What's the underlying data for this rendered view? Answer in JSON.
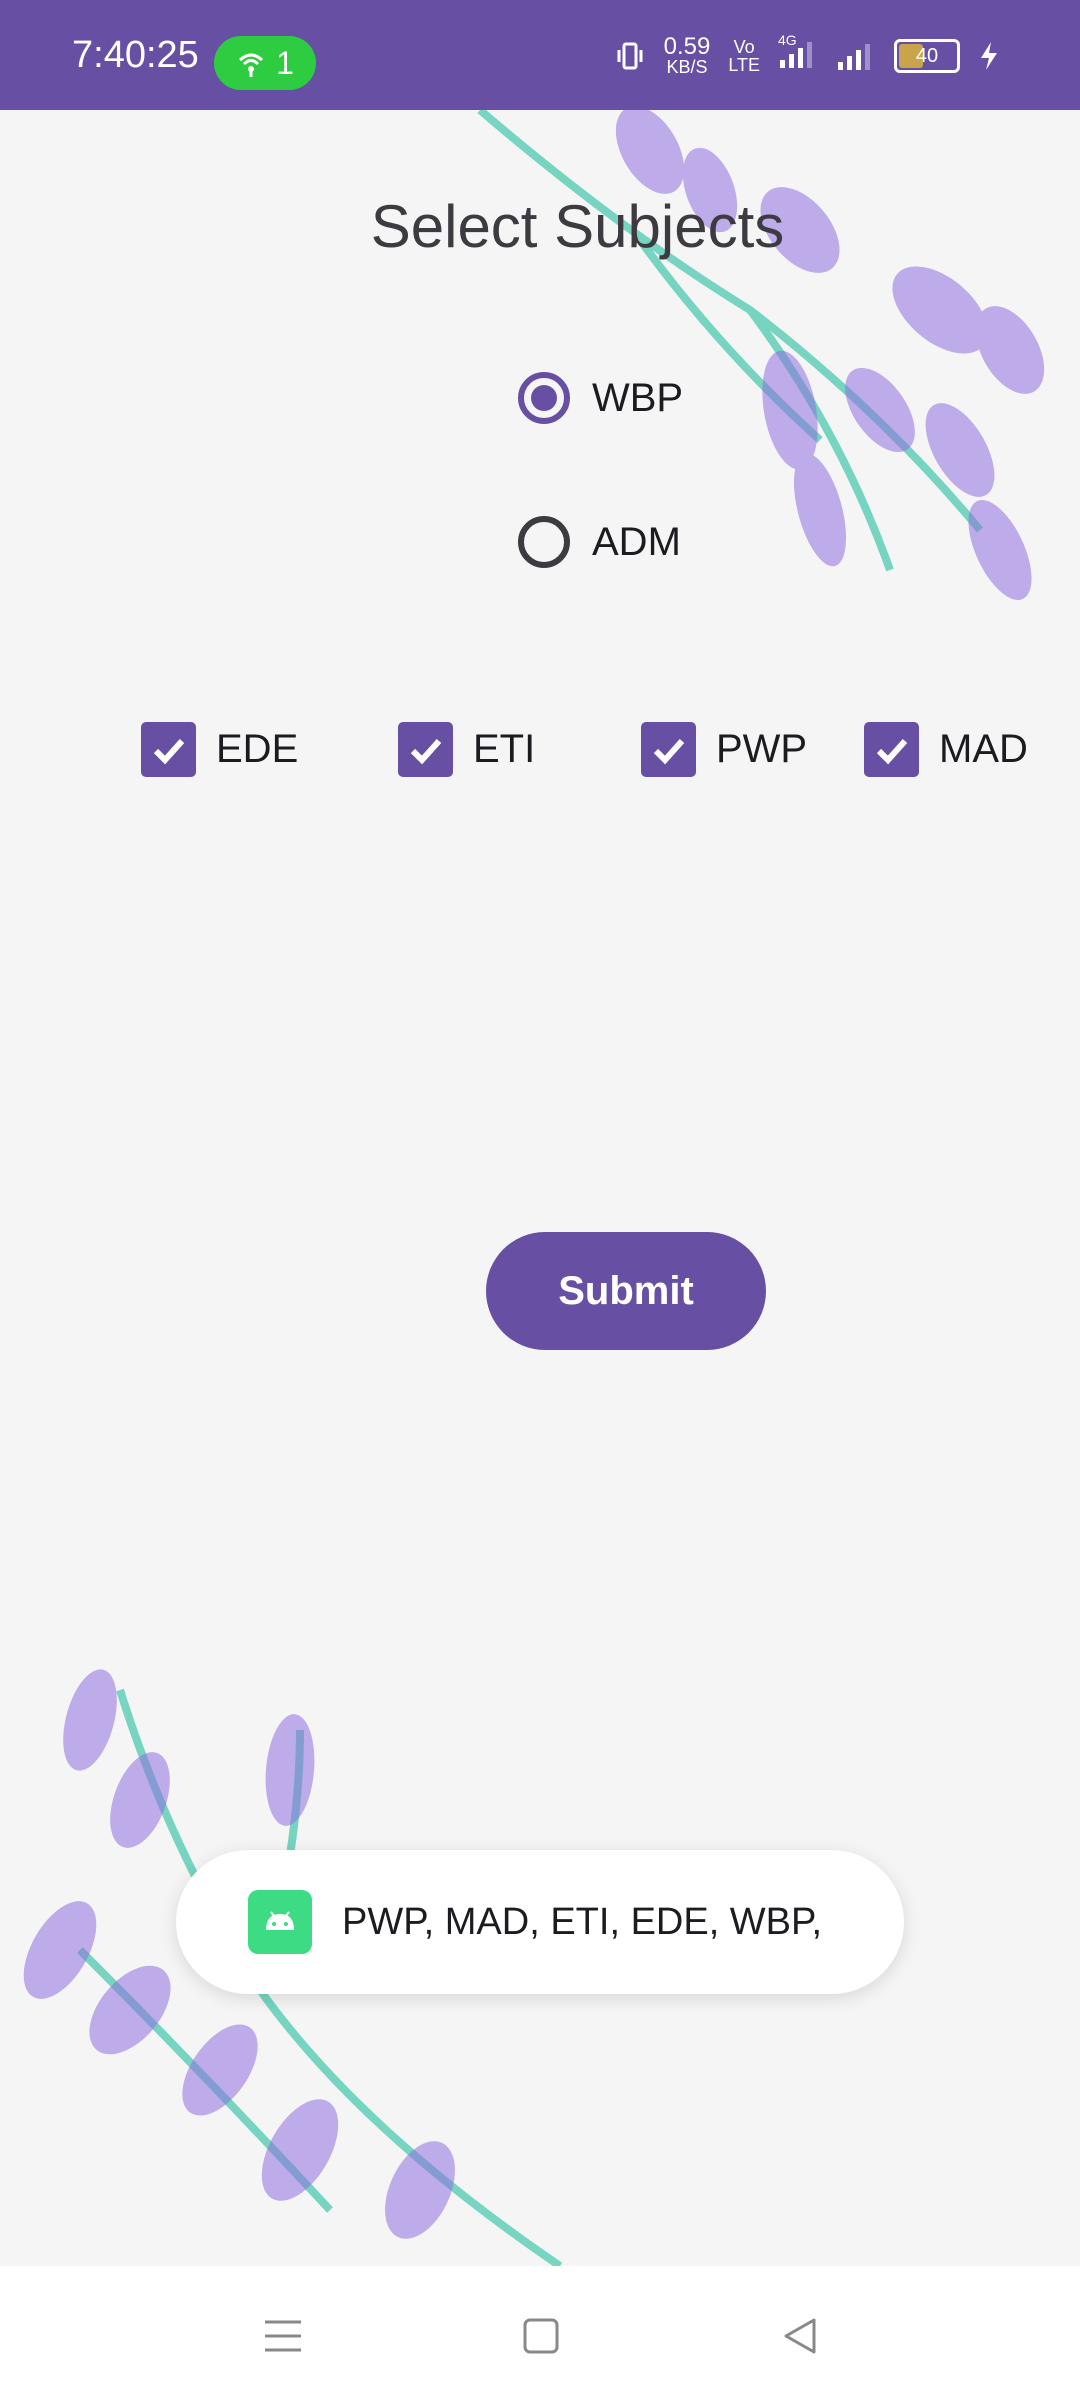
{
  "status_bar": {
    "time": "7:40:25",
    "hotspot_count": "1",
    "speed_value": "0.59",
    "speed_unit": "KB/S",
    "volte_top": "Vo",
    "volte_bottom": "LTE",
    "network_type": "4G",
    "battery_level": "40",
    "icons": [
      "hotspot-icon",
      "vibrate-icon",
      "signal-icon",
      "signal-icon",
      "battery-icon",
      "charging-icon"
    ]
  },
  "screen": {
    "title": "Select Subjects",
    "radio_options": [
      {
        "label": "WBP",
        "selected": true
      },
      {
        "label": "ADM",
        "selected": false
      }
    ],
    "checkboxes": [
      {
        "label": "EDE",
        "checked": true
      },
      {
        "label": "ETI",
        "checked": true
      },
      {
        "label": "PWP",
        "checked": true
      },
      {
        "label": "MAD",
        "checked": true
      }
    ],
    "submit_label": "Submit"
  },
  "toast": {
    "message": "PWP, MAD, ETI, EDE, WBP,",
    "icon": "android-icon"
  },
  "colors": {
    "accent": "#6750a4",
    "background": "#f5f5f6",
    "toast_icon": "#3ddc84"
  },
  "nav_bar": {
    "icons": [
      "menu-icon",
      "home-icon",
      "back-icon"
    ]
  }
}
